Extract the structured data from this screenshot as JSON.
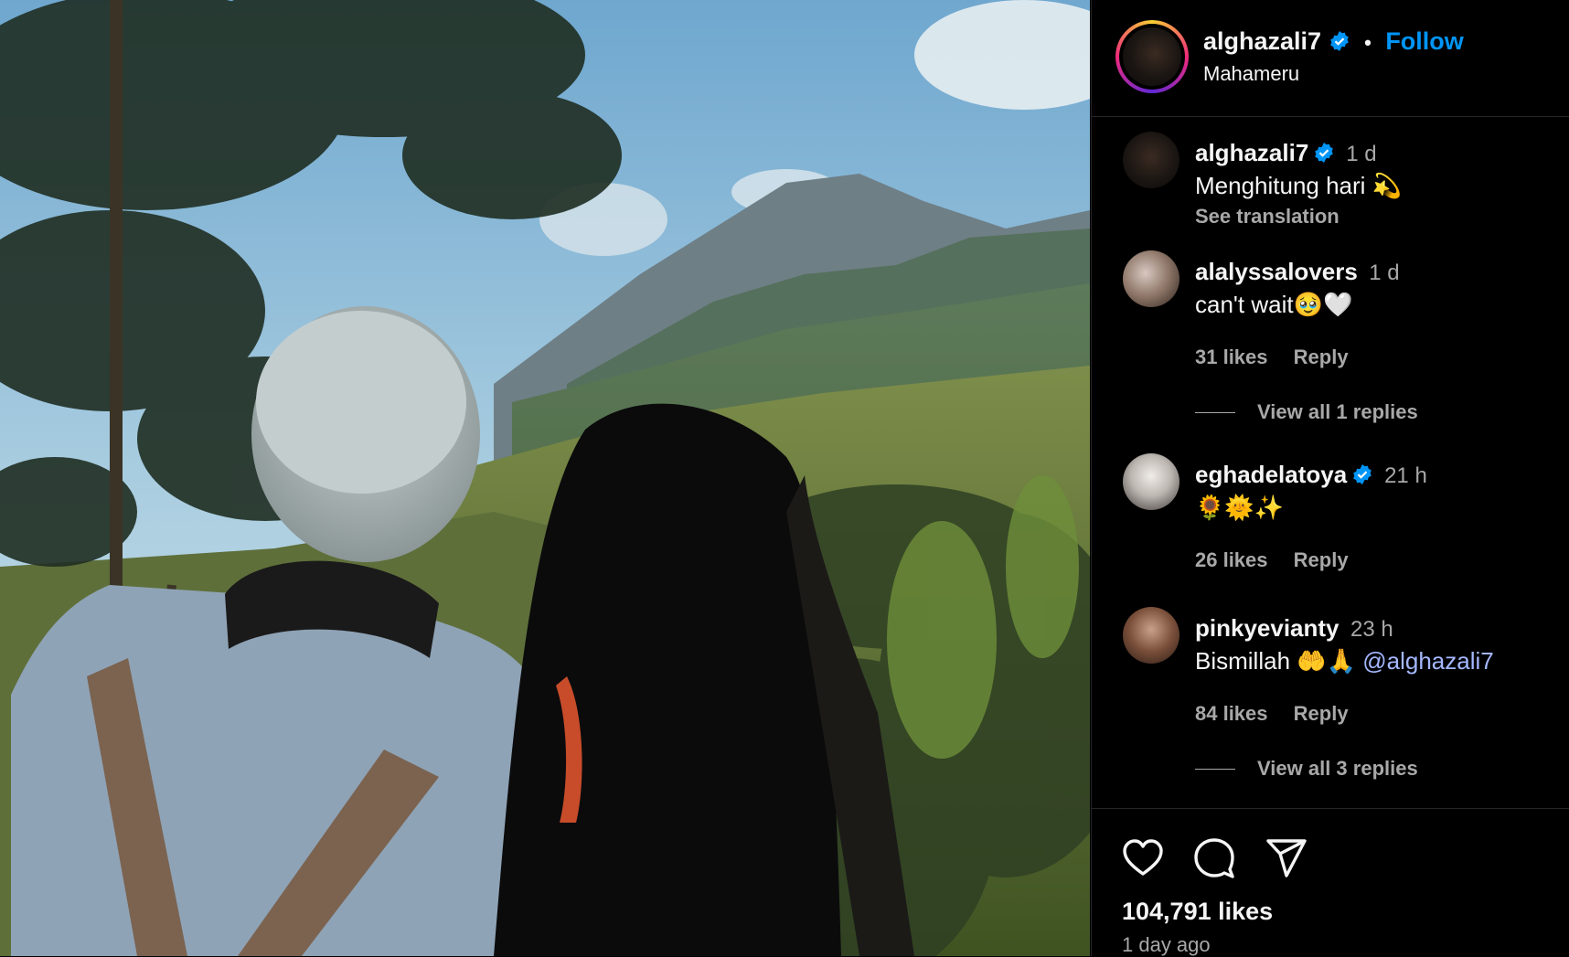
{
  "post": {
    "username": "alghazali7",
    "follow_label": "Follow",
    "separator": "•",
    "location": "Mahameru"
  },
  "comments": [
    {
      "username": "alghazali7",
      "verified": true,
      "time": "1 d",
      "text": "Menghitung hari 💫",
      "see_translation": "See translation"
    },
    {
      "username": "alalyssalovers",
      "verified": false,
      "time": "1 d",
      "text": "can't wait🥹🤍",
      "likes": "31 likes",
      "reply": "Reply",
      "view_replies": "View all 1 replies"
    },
    {
      "username": "eghadelatoya",
      "verified": true,
      "time": "21 h",
      "text": "🌻🌞✨",
      "likes": "26 likes",
      "reply": "Reply"
    },
    {
      "username": "pinkyevianty",
      "verified": false,
      "time": "23 h",
      "text": "Bismillah 🤲🙏",
      "mention": "@alghazali7",
      "likes": "84 likes",
      "reply": "Reply",
      "view_replies": "View all 3 replies"
    }
  ],
  "footer": {
    "icons": [
      "heart-icon",
      "comment-icon",
      "share-icon"
    ],
    "likes": "104,791 likes",
    "time_ago": "1 day ago"
  },
  "colors": {
    "accent": "#0095f6",
    "secondary_text": "#a8a8a8",
    "background": "#000000"
  }
}
